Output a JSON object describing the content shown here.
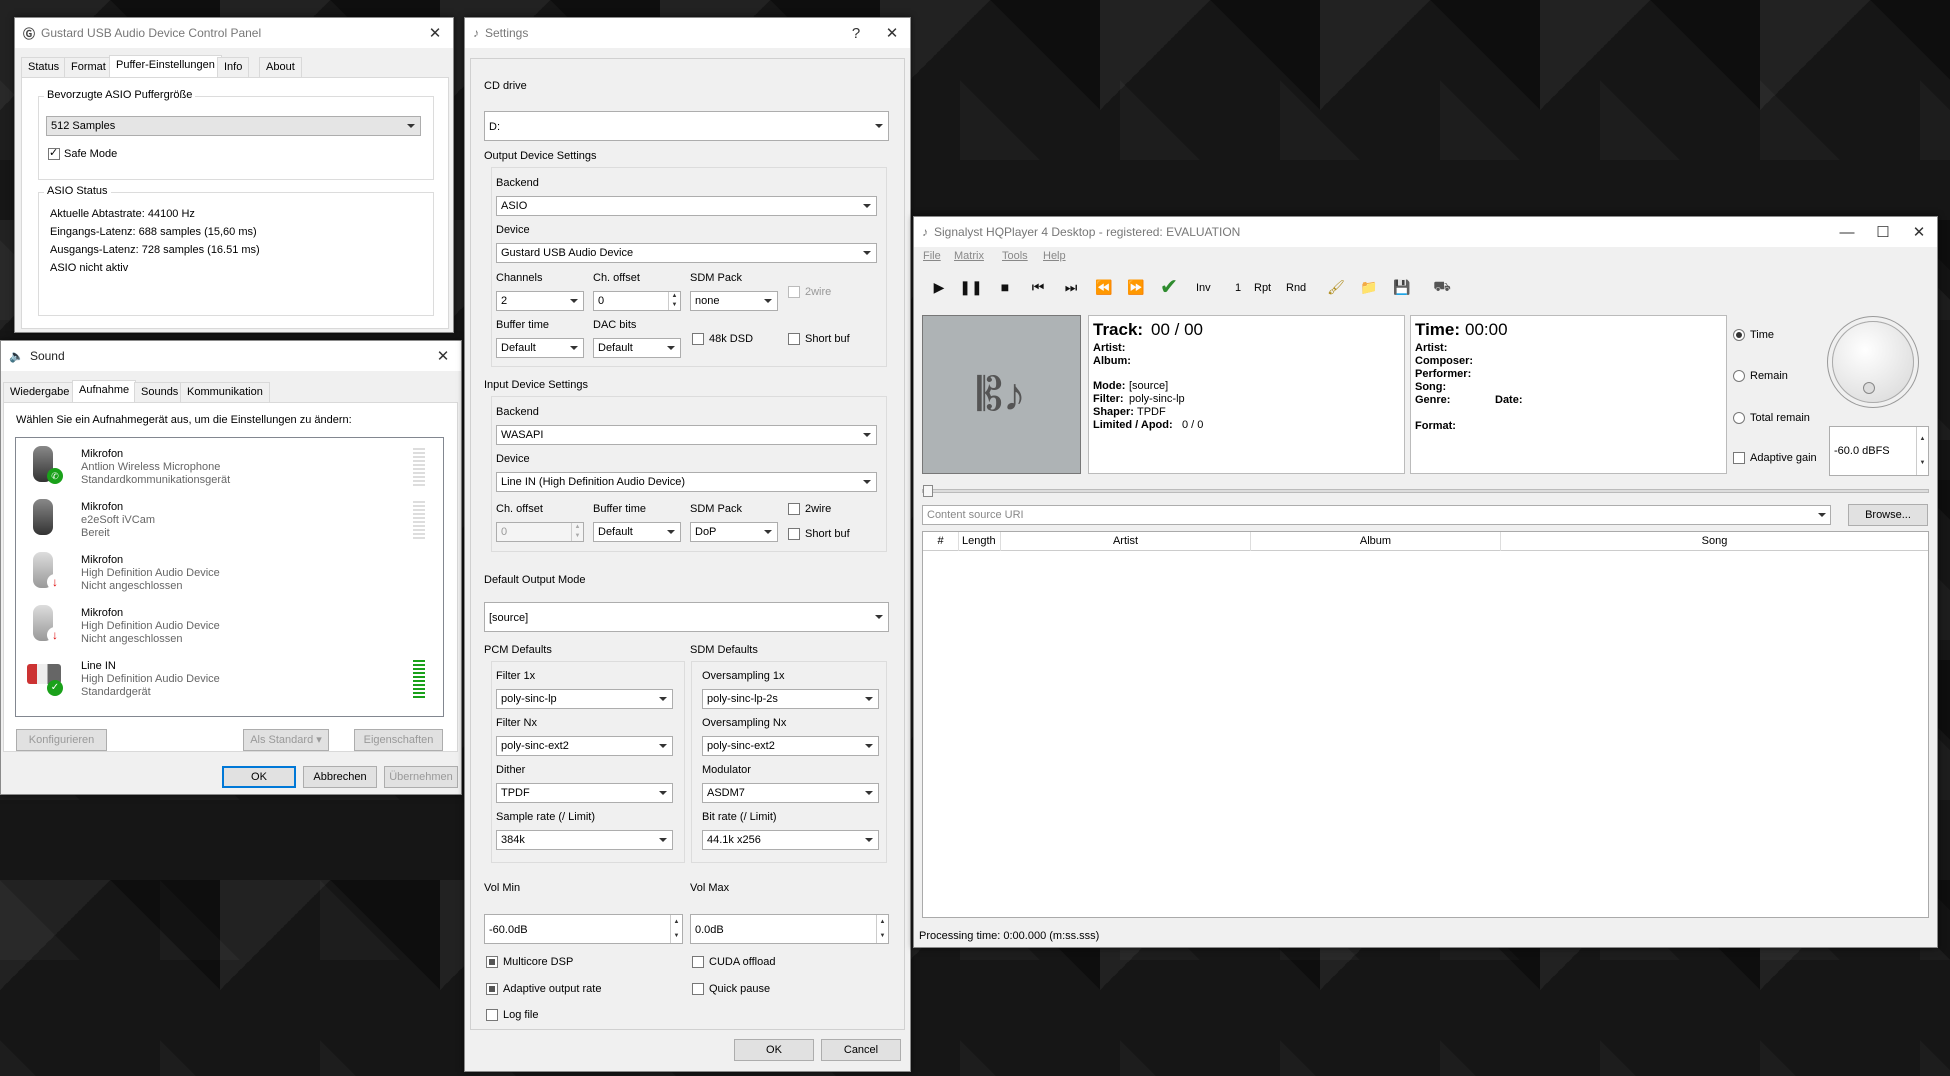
{
  "gustard": {
    "title": "Gustard USB Audio Device Control Panel",
    "tabs": [
      "Status",
      "Format",
      "Puffer-Einstellungen",
      "Info",
      "About"
    ],
    "buffer_group": "Bevorzugte ASIO Puffergröße",
    "buffer_value": "512 Samples",
    "safe_mode": "Safe Mode",
    "asio_group": "ASIO Status",
    "status_lines": [
      "Aktuelle Abtastrate: 44100 Hz",
      "Eingangs-Latenz: 688 samples (15,60 ms)",
      "Ausgangs-Latenz: 728 samples (16.51 ms)",
      "ASIO nicht aktiv"
    ]
  },
  "sound": {
    "title": "Sound",
    "tabs": [
      "Wiedergabe",
      "Aufnahme",
      "Sounds",
      "Kommunikation"
    ],
    "instruction": "Wählen Sie ein Aufnahmegerät aus, um die Einstellungen zu ändern:",
    "devices": [
      {
        "name": "Mikrofon",
        "desc1": "Antlion Wireless Microphone",
        "desc2": "Standardkommunikationsgerät",
        "status": "comm-default"
      },
      {
        "name": "Mikrofon",
        "desc1": "e2eSoft iVCam",
        "desc2": "Bereit",
        "status": "ready"
      },
      {
        "name": "Mikrofon",
        "desc1": "High Definition Audio Device",
        "desc2": "Nicht angeschlossen",
        "status": "disconnected"
      },
      {
        "name": "Mikrofon",
        "desc1": "High Definition Audio Device",
        "desc2": "Nicht angeschlossen",
        "status": "disconnected"
      },
      {
        "name": "Line IN",
        "desc1": "High Definition Audio Device",
        "desc2": "Standardgerät",
        "status": "default"
      }
    ],
    "configure": "Konfigurieren",
    "set_default": "Als Standard",
    "properties": "Eigenschaften",
    "ok": "OK",
    "cancel": "Abbrechen",
    "apply": "Übernehmen"
  },
  "settings": {
    "title": "Settings",
    "cd_drive_label": "CD drive",
    "cd_drive": "D:",
    "output_group": "Output Device Settings",
    "backend_label": "Backend",
    "out_backend": "ASIO",
    "device_label": "Device",
    "out_device": "Gustard USB Audio Device",
    "channels_label": "Channels",
    "channels": "2",
    "ch_offset_label": "Ch. offset",
    "ch_offset": "0",
    "sdm_pack_label": "SDM Pack",
    "out_sdm_pack": "none",
    "twowire": "2wire",
    "buffer_time_label": "Buffer time",
    "out_buffer_time": "Default",
    "dac_bits_label": "DAC bits",
    "dac_bits": "Default",
    "dsd48k": "48k DSD",
    "short_buf": "Short buf",
    "input_group": "Input Device Settings",
    "in_backend": "WASAPI",
    "in_device": "Line IN (High Definition Audio Device)",
    "in_ch_offset": "0",
    "in_buffer_time": "Default",
    "in_sdm_pack": "DoP",
    "default_mode_label": "Default Output Mode",
    "default_mode": "[source]",
    "pcm_label": "PCM Defaults",
    "sdm_label": "SDM Defaults",
    "filter1x_label": "Filter 1x",
    "filter1x": "poly-sinc-lp",
    "filternx_label": "Filter Nx",
    "filternx": "poly-sinc-ext2",
    "dither_label": "Dither",
    "dither": "TPDF",
    "samplerate_label": "Sample rate (/ Limit)",
    "samplerate": "384k",
    "os1x_label": "Oversampling 1x",
    "os1x": "poly-sinc-lp-2s",
    "osnx_label": "Oversampling Nx",
    "osnx": "poly-sinc-ext2",
    "modulator_label": "Modulator",
    "modulator": "ASDM7",
    "bitrate_label": "Bit rate (/ Limit)",
    "bitrate": "44.1k x256",
    "volmin_label": "Vol Min",
    "volmin": "-60.0dB",
    "volmax_label": "Vol Max",
    "volmax": "0.0dB",
    "multicore": "Multicore DSP",
    "cuda": "CUDA offload",
    "adaptive_rate": "Adaptive output rate",
    "quick_pause": "Quick pause",
    "log_file": "Log file",
    "ok": "OK",
    "cancel": "Cancel"
  },
  "hqplayer": {
    "title": "Signalyst HQPlayer 4 Desktop - registered: EVALUATION",
    "menu": [
      "File",
      "Matrix",
      "Tools",
      "Help"
    ],
    "inv": "Inv",
    "one": "1",
    "rpt": "Rpt",
    "rnd": "Rnd",
    "track_label": "Track:",
    "track": "00 / 00",
    "artist_label": "Artist:",
    "album_label": "Album:",
    "mode_label": "Mode:",
    "mode": "[source]",
    "filter_label": "Filter:",
    "filter": "poly-sinc-lp",
    "shaper_label": "Shaper:",
    "shaper": "TPDF",
    "limited_label": "Limited / Apod:",
    "limited": "0 / 0",
    "time_label": "Time:",
    "time": "00:00",
    "composer_label": "Composer:",
    "performer_label": "Performer:",
    "song_label": "Song:",
    "genre_label": "Genre:",
    "date_label": "Date:",
    "format_label": "Format:",
    "radio_time": "Time",
    "radio_remain": "Remain",
    "radio_total": "Total remain",
    "adaptive_gain": "Adaptive gain",
    "volume": "-60.0 dBFS",
    "uri_placeholder": "Content source URI",
    "browse": "Browse...",
    "columns": [
      "#",
      "Length",
      "Artist",
      "Album",
      "Song"
    ],
    "processing": "Processing time: 0:00.000 (m:ss.sss)"
  }
}
